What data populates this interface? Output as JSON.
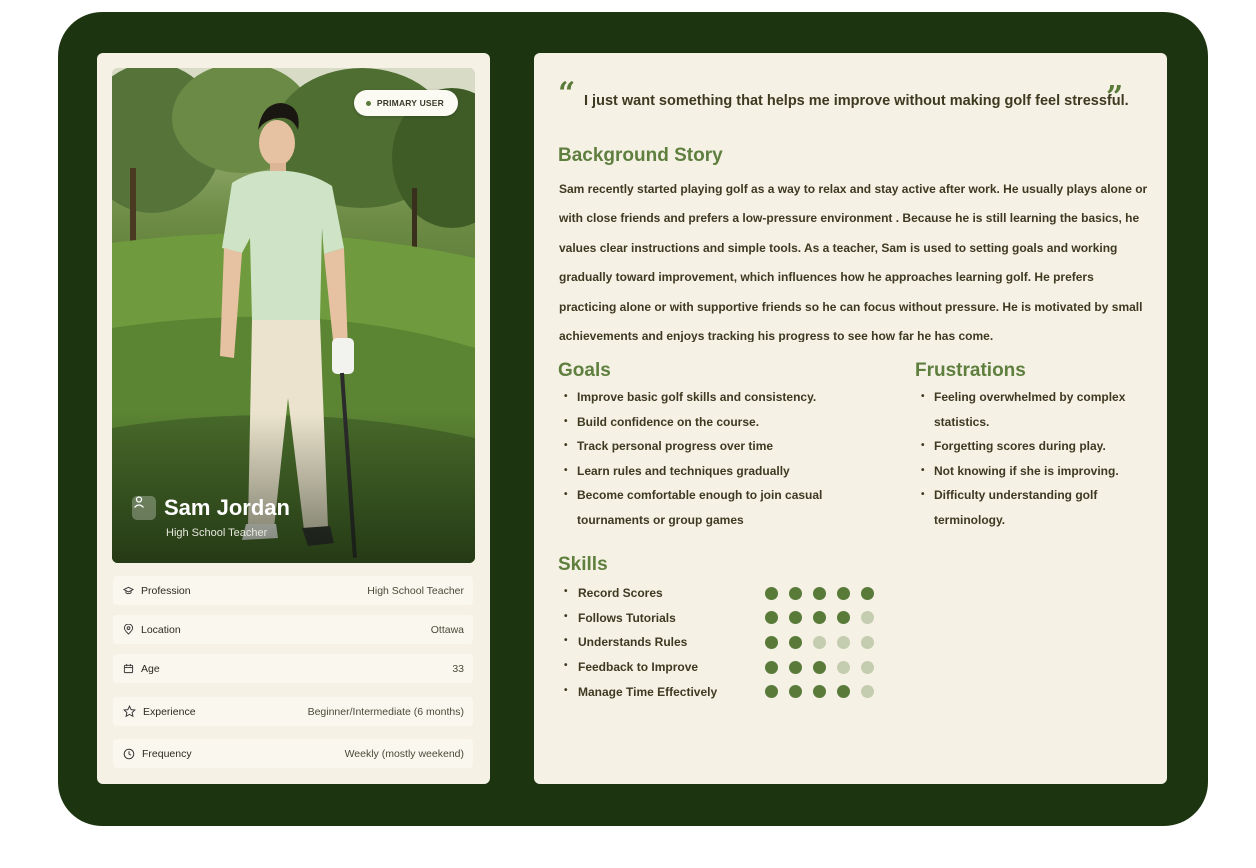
{
  "profile": {
    "badge": "PRIMARY USER",
    "name": "Sam Jordan",
    "role": "High School Teacher",
    "details": [
      {
        "label": "Profession",
        "value": "High School Teacher",
        "icon": "graduation-cap-icon"
      },
      {
        "label": "Location",
        "value": "Ottawa",
        "icon": "location-pin-icon"
      },
      {
        "label": "Age",
        "value": "33",
        "icon": "calendar-icon"
      },
      {
        "label": "Experience",
        "value": "Beginner/Intermediate (6 months)",
        "icon": "star-icon"
      },
      {
        "label": "Frequency",
        "value": "Weekly (mostly weekend)",
        "icon": "clock-icon"
      }
    ]
  },
  "quote": {
    "open": "“",
    "text": "I just want something that helps me improve without making golf feel stressful.",
    "close": "”"
  },
  "background": {
    "title": "Background Story",
    "text": "Sam recently started playing golf as a way to relax and stay active after work. He usually plays alone or with close friends and prefers a low-pressure environment . Because he is still learning the basics, he values clear instructions and simple tools. As a teacher, Sam is used to setting goals and working gradually toward improvement, which influences how he approaches learning golf. He prefers practicing alone or with supportive friends so he can focus without pressure. He is motivated by small achievements and enjoys tracking his progress to see how far he has come."
  },
  "goals": {
    "title": "Goals",
    "items": [
      "Improve basic golf skills and consistency.",
      "Build confidence on the course.",
      "Track personal progress over time",
      "Learn rules and techniques gradually",
      "Become comfortable enough to join casual tournaments or group games"
    ]
  },
  "frustrations": {
    "title": "Frustrations",
    "items": [
      "Feeling overwhelmed by complex statistics.",
      "Forgetting scores during play.",
      "Not knowing if she is improving.",
      "Difficulty understanding golf terminology."
    ]
  },
  "skills": {
    "title": "Skills",
    "max": 5,
    "items": [
      {
        "name": "Record Scores",
        "level": 5
      },
      {
        "name": "Follows Tutorials",
        "level": 4
      },
      {
        "name": "Understands Rules",
        "level": 2
      },
      {
        "name": "Feedback to Improve",
        "level": 3
      },
      {
        "name": "Manage Time Effectively",
        "level": 4
      }
    ]
  },
  "colors": {
    "frame": "#1d3410",
    "card": "#f6f1e5",
    "accent": "#5a7a3a",
    "dot_off": "#c5cdb0"
  }
}
